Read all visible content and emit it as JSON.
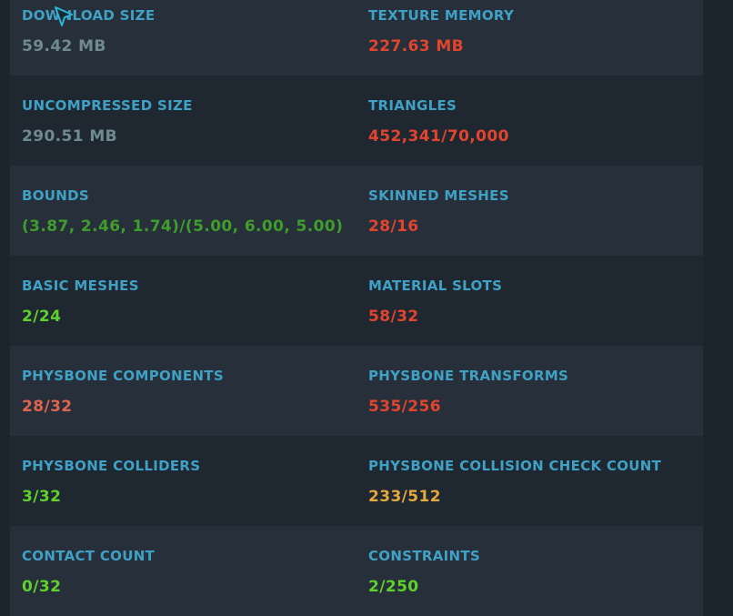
{
  "stats": [
    {
      "left": {
        "label": "DOWNLOAD SIZE",
        "value": "59.42 MB",
        "color": "gray"
      },
      "right": {
        "label": "TEXTURE MEMORY",
        "value": "227.63 MB",
        "color": "red"
      }
    },
    {
      "left": {
        "label": "UNCOMPRESSED SIZE",
        "value": "290.51 MB",
        "color": "gray"
      },
      "right": {
        "label": "TRIANGLES",
        "value": "452,341/70,000",
        "color": "red"
      }
    },
    {
      "left": {
        "label": "BOUNDS",
        "value": "(3.87, 2.46, 1.74)/(5.00, 6.00, 5.00)",
        "color": "olive"
      },
      "right": {
        "label": "SKINNED MESHES",
        "value": "28/16",
        "color": "red"
      }
    },
    {
      "left": {
        "label": "BASIC MESHES",
        "value": "2/24",
        "color": "green"
      },
      "right": {
        "label": "MATERIAL SLOTS",
        "value": "58/32",
        "color": "red"
      }
    },
    {
      "left": {
        "label": "PHYSBONE COMPONENTS",
        "value": "28/32",
        "color": "salmon"
      },
      "right": {
        "label": "PHYSBONE TRANSFORMS",
        "value": "535/256",
        "color": "red"
      }
    },
    {
      "left": {
        "label": "PHYSBONE COLLIDERS",
        "value": "3/32",
        "color": "green"
      },
      "right": {
        "label": "PHYSBONE COLLISION CHECK COUNT",
        "value": "233/512",
        "color": "yellow"
      }
    },
    {
      "left": {
        "label": "CONTACT COUNT",
        "value": "0/32",
        "color": "green"
      },
      "right": {
        "label": "CONSTRAINTS",
        "value": "2/250",
        "color": "green"
      }
    }
  ],
  "colors": {
    "label": "#3fa1c6",
    "gray": "#6f8a90",
    "red": "#e3442e",
    "salmon": "#e0644e",
    "olive": "#3f9d2b",
    "green": "#5ed12c",
    "yellow": "#e5a83a"
  },
  "cursor_icon": "pointer-cursor-icon"
}
